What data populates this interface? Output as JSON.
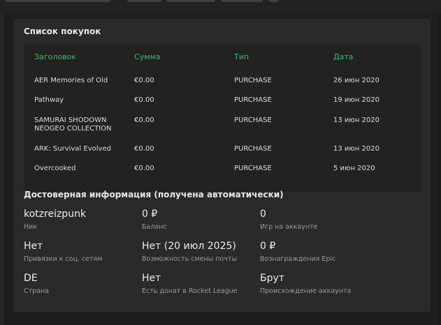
{
  "purchases": {
    "title": "Список покупок",
    "columns": [
      "Заголовок",
      "Сумма",
      "Тип",
      "Дата"
    ],
    "rows": [
      {
        "title": "AER Memories of Old",
        "amount": "€0.00",
        "type": "PURCHASE",
        "date": "26 июн 2020"
      },
      {
        "title": "Pathway",
        "amount": "€0.00",
        "type": "PURCHASE",
        "date": "19 июн 2020"
      },
      {
        "title": "SAMURAI SHODOWN NEOGEO COLLECTION",
        "amount": "€0.00",
        "type": "PURCHASE",
        "date": "13 июн 2020"
      },
      {
        "title": "ARK: Survival Evolved",
        "amount": "€0.00",
        "type": "PURCHASE",
        "date": "13 июн 2020"
      },
      {
        "title": "Overcooked",
        "amount": "€0.00",
        "type": "PURCHASE",
        "date": "5 июн 2020"
      }
    ]
  },
  "info": {
    "title": "Достоверная информация (получена автоматически)",
    "items": [
      {
        "value": "kotzreizpunk",
        "label": "Ник"
      },
      {
        "value": "0 ₽",
        "label": "Баланс"
      },
      {
        "value": "0",
        "label": "Игр на аккаунте"
      },
      {
        "value": "Нет",
        "label": "Привязки к соц. сетям"
      },
      {
        "value": "Нет (20 июл 2025)",
        "label": "Возможность смены почты"
      },
      {
        "value": "0 ₽",
        "label": "Вознаграждения Epic"
      },
      {
        "value": "DE",
        "label": "Страна"
      },
      {
        "value": "Нет",
        "label": "Есть донат в Rocket League"
      },
      {
        "value": "Брут",
        "label": "Происхождение аккаунта"
      }
    ]
  }
}
